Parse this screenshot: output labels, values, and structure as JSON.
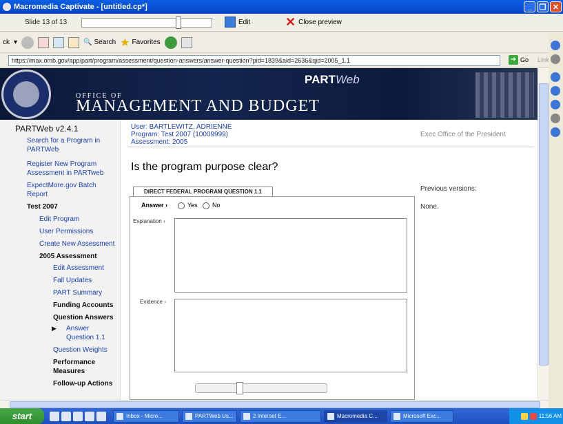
{
  "window": {
    "title": "Macromedia Captivate - [untitled.cp*]"
  },
  "captivate": {
    "slide_label": "Slide 13 of 13",
    "edit_label": "Edit",
    "close_preview_label": "Close preview"
  },
  "ie_toolbar": {
    "back_label": "ck",
    "search_label": "Search",
    "favorites_label": "Favorites"
  },
  "address": {
    "url": "https://max.omb.gov/app/part/program/assessment/question-answers/answer-question?pid=1839&aid=2636&qid=2005_1.1",
    "go_label": "Go",
    "links_label": "Links"
  },
  "banner": {
    "office_of": "OFFICE OF",
    "management": "MANAGEMENT AND BUDGET",
    "part": "PART",
    "web": "Web"
  },
  "nav": {
    "version": "PARTWeb v2.4.1",
    "search_line1": "Search for a Program in",
    "search_line2": "PARTWeb",
    "register_line1": "Register New Program",
    "register_line2": "Assessment in PARTweb",
    "expect_line1": "ExpectMore.gov Batch",
    "expect_line2": "Report",
    "test2007": "Test 2007",
    "edit_program": "Edit Program",
    "user_permissions": "User Permissions",
    "create_assessment": "Create New Assessment",
    "assessment_2005": "2005 Assessment",
    "edit_assessment": "Edit Assessment",
    "fall_updates": "Fall Updates",
    "part_summary": "PART Summary",
    "funding_accounts": "Funding Accounts",
    "question_answers": "Question Answers",
    "answer": "Answer",
    "question_11": "Question 1.1",
    "question_weights": "Question Weights",
    "performance_line1": "Performance",
    "performance_line2": "Measures",
    "followup": "Follow-up Actions"
  },
  "info": {
    "user": "User: BARTLEWITZ, ADRIENNE",
    "program": "Program: Test 2007 (10009999)",
    "assessment": "Assessment: 2005",
    "agency": "Exec Office of the President"
  },
  "question": {
    "title": "Is the program purpose clear?",
    "tab": "DIRECT FEDERAL PROGRAM QUESTION 1.1",
    "answer_label": "Answer",
    "yes": "Yes",
    "no": "No",
    "explanation_label": "Explanation",
    "evidence_label": "Evidence"
  },
  "previous": {
    "label": "Previous versions:",
    "value": "None."
  },
  "taskbar": {
    "start": "start",
    "tasks": [
      "Inbox - Micro...",
      "PARTWeb Us...",
      "2 Internet E...",
      "Macromedia C...",
      "Microsoft Exc..."
    ],
    "clock": "11:56 AM"
  }
}
